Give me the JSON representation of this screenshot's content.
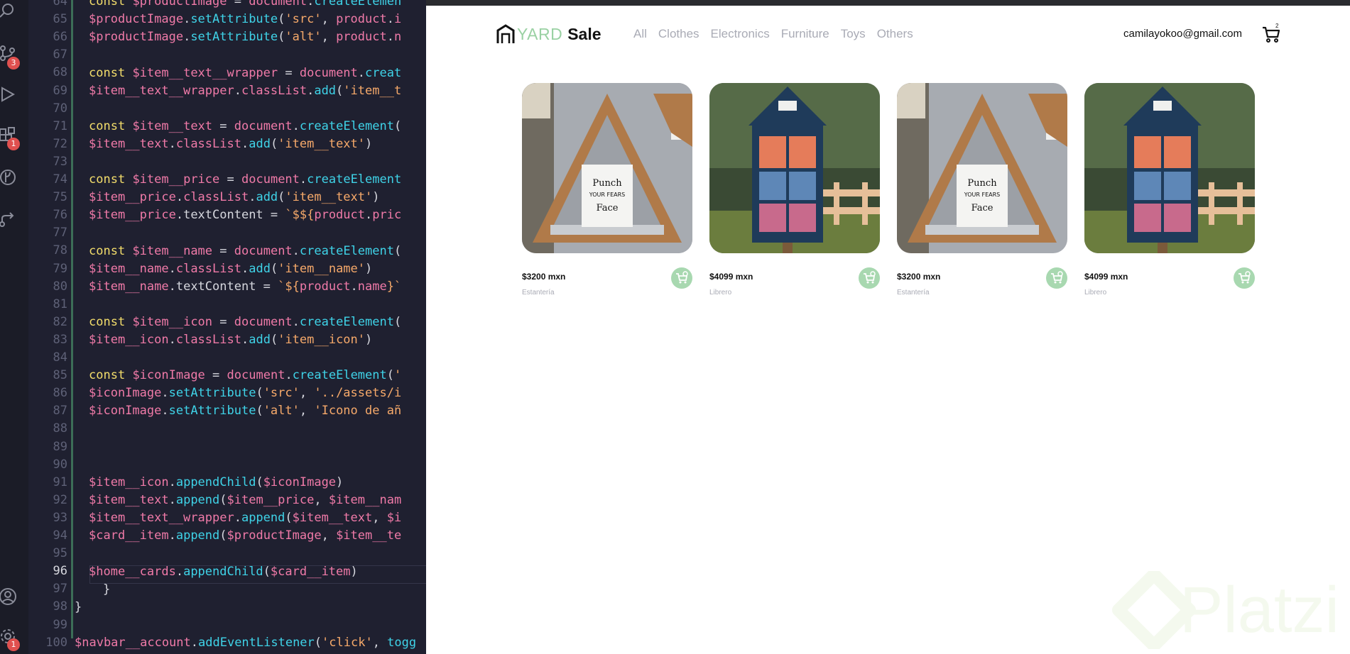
{
  "editor": {
    "activity_badges": {
      "scm": "3",
      "extensions": "1",
      "settings": "1"
    },
    "line_numbers": [
      "64",
      "65",
      "66",
      "67",
      "68",
      "69",
      "70",
      "71",
      "72",
      "73",
      "74",
      "75",
      "76",
      "77",
      "78",
      "79",
      "80",
      "81",
      "82",
      "83",
      "84",
      "85",
      "86",
      "87",
      "88",
      "89",
      "90",
      "91",
      "92",
      "93",
      "94",
      "95",
      "96",
      "97",
      "98",
      "99",
      "100"
    ],
    "active_line": "96"
  },
  "browser": {
    "logo": {
      "yard": "YARD",
      "sale": "Sale"
    },
    "nav_links": [
      "All",
      "Clothes",
      "Electronics",
      "Furniture",
      "Toys",
      "Others"
    ],
    "account_email": "camilayokoo@gmail.com",
    "cart_count": "2",
    "products": [
      {
        "price": "$3200 mxn",
        "name": "Estantería",
        "image": "triangle-shelf"
      },
      {
        "price": "$4099 mxn",
        "name": "Librero",
        "image": "little-library"
      },
      {
        "price": "$3200 mxn",
        "name": "Estantería",
        "image": "triangle-shelf"
      },
      {
        "price": "$4099 mxn",
        "name": "Librero",
        "image": "little-library"
      }
    ],
    "watermark": "Platzi",
    "colors": {
      "accent": "#9ad1a3",
      "add_button": "#a8d8b0",
      "muted_text": "#a9abb5"
    }
  }
}
